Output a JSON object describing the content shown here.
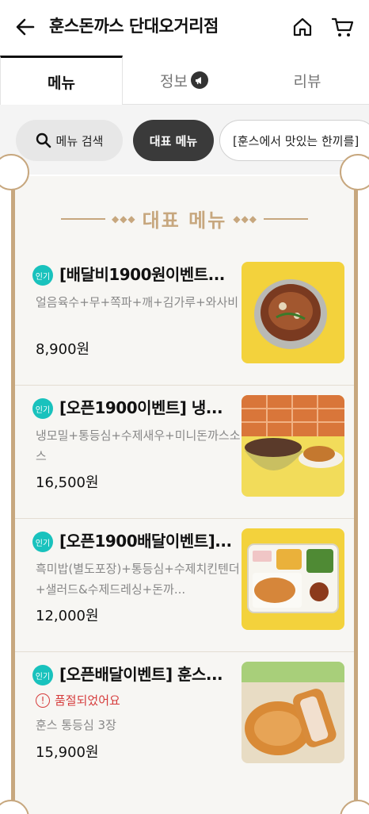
{
  "header": {
    "title": "훈스돈까스 단대오거리점"
  },
  "tabs": [
    {
      "label": "메뉴"
    },
    {
      "label": "정보"
    },
    {
      "label": "리뷰"
    }
  ],
  "chips": {
    "search": "메뉴 검색",
    "representative": "대표 메뉴",
    "event": "[훈스에서 맛있는 한끼를]"
  },
  "board": {
    "title": "대표 메뉴",
    "badge": "인기",
    "items": [
      {
        "name": "[배달비1900원이벤트...",
        "desc": "얼음육수+무+쪽파+깨+김가루+와사비",
        "price": "8,900원"
      },
      {
        "name": "[오픈1900이벤트] 냉...",
        "desc": "냉모밀+통등심+수제새우+미니돈까스소스",
        "price": "16,500원"
      },
      {
        "name": "[오픈1900배달이벤트]...",
        "desc": "흑미밥(별도포장)+통등심+수제치킨텐더+샐러드&수제드레싱+돈까...",
        "price": "12,000원"
      },
      {
        "name": "[오픈배달이벤트] 훈스...",
        "soldout": "품절되었어요",
        "desc": "훈스 통등심 3장",
        "price": "15,900원"
      }
    ]
  },
  "colors": {
    "accent": "#c7a77e",
    "badge": "#19c2bd",
    "soldout": "#d63c3c"
  }
}
